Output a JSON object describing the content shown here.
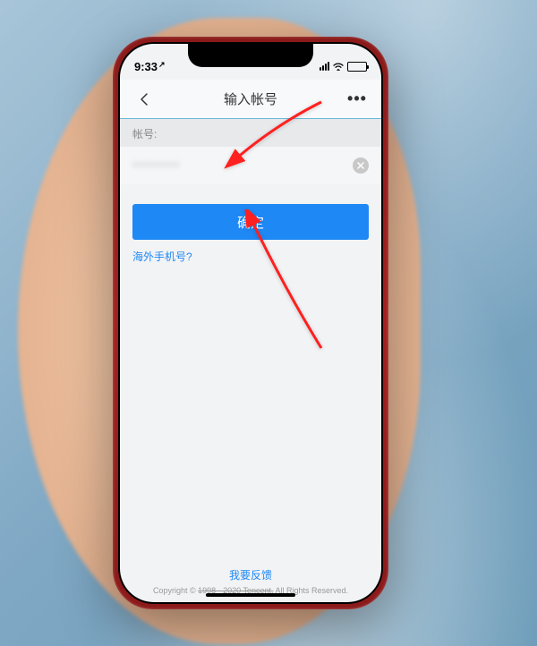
{
  "status": {
    "time": "9:33",
    "time_indicator": "↗"
  },
  "nav": {
    "title": "输入帐号",
    "more": "•••"
  },
  "form": {
    "account_label": "帐号:",
    "account_value": "••••••••",
    "confirm_label": "确定",
    "overseas_link": "海外手机号?"
  },
  "footer": {
    "feedback": "我要反馈",
    "copyright_prefix": "Copyright © ",
    "copyright_struck": "1998 - 2020 Tencent.",
    "copyright_suffix": "All Rights Reserved."
  }
}
